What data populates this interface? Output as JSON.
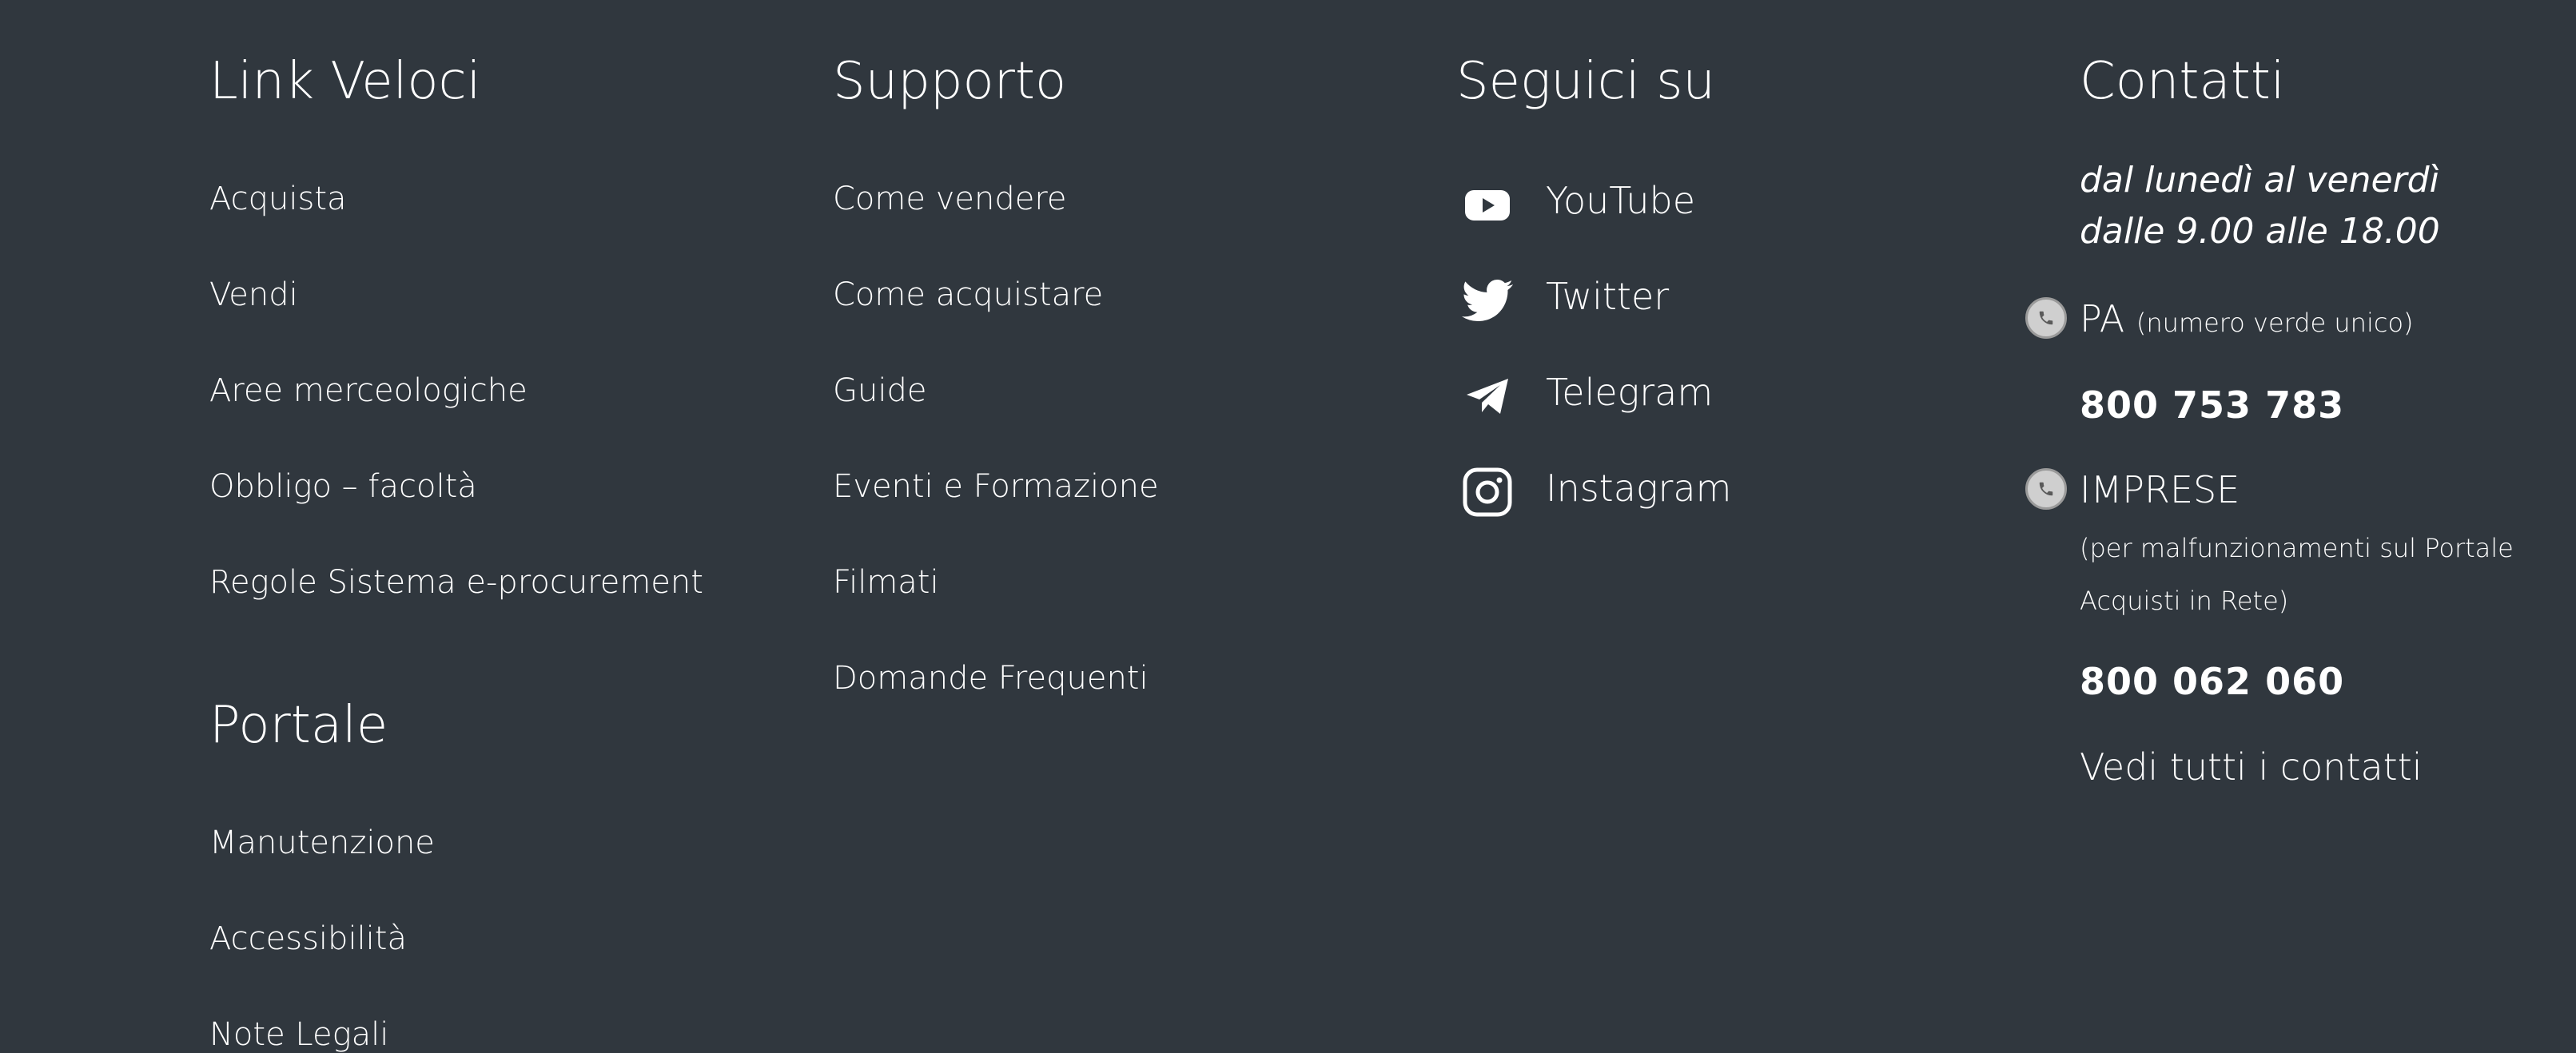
{
  "link_veloci": {
    "title": "Link Veloci",
    "items": [
      "Acquista",
      "Vendi",
      "Aree merceologiche",
      "Obbligo – facoltà",
      "Regole Sistema e-procurement"
    ]
  },
  "portale": {
    "title": "Portale",
    "items": [
      "Manutenzione",
      "Accessibilità",
      "Note Legali"
    ]
  },
  "supporto": {
    "title": "Supporto",
    "items": [
      "Come vendere",
      "Come acquistare",
      "Guide",
      "Eventi e Formazione",
      "Filmati",
      "Domande Frequenti"
    ]
  },
  "seguici": {
    "title": "Seguici su",
    "items": [
      {
        "label": "YouTube",
        "icon": "youtube-icon"
      },
      {
        "label": "Twitter",
        "icon": "twitter-icon"
      },
      {
        "label": "Telegram",
        "icon": "telegram-icon"
      },
      {
        "label": "Instagram",
        "icon": "instagram-icon"
      }
    ]
  },
  "contatti": {
    "title": "Contatti",
    "hours_line1": "dal lunedì al venerdì",
    "hours_line2": "dalle 9.00 alle 18.00",
    "pa_label": "PA",
    "pa_note": "(numero verde unico)",
    "pa_number": "800 753 783",
    "imprese_label": "IMPRESE",
    "imprese_note_line1": "(per malfunzionamenti sul Portale",
    "imprese_note_line2": "Acquisti in Rete)",
    "imprese_number": "800 062 060",
    "see_all": "Vedi tutti i contatti"
  },
  "colors": {
    "background": "#30373e",
    "text": "#ffffff"
  }
}
